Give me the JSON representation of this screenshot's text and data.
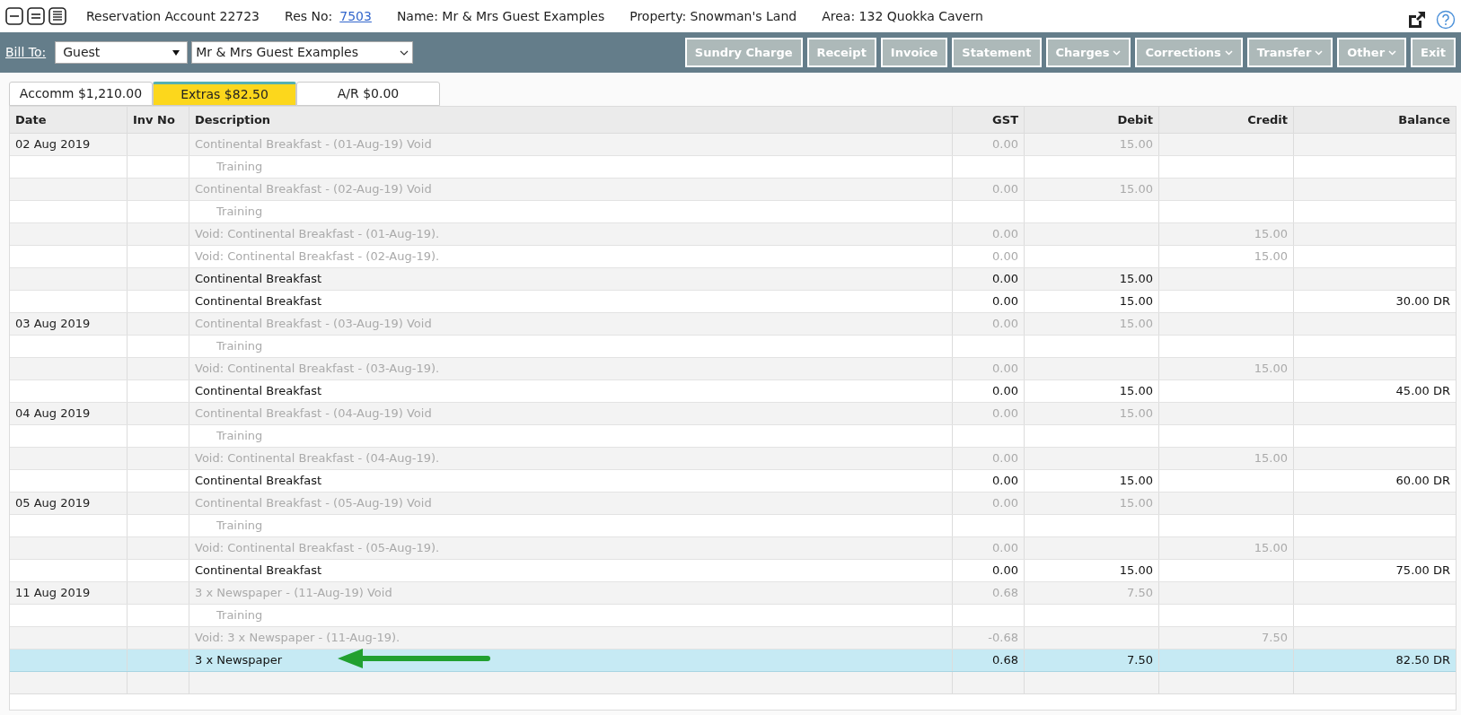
{
  "header": {
    "title": "Reservation Account 22723",
    "res_no_label": "Res No:",
    "res_no": "7503",
    "name": "Name: Mr & Mrs Guest Examples",
    "property": "Property: Snowman's Land",
    "area": "Area: 132 Quokka Cavern"
  },
  "toolbar": {
    "bill_to_label": "Bill To:",
    "bill_to_type": "Guest",
    "bill_to_name": "Mr & Mrs Guest Examples",
    "buttons": [
      {
        "label": "Sundry Charge",
        "dropdown": false
      },
      {
        "label": "Receipt",
        "dropdown": false
      },
      {
        "label": "Invoice",
        "dropdown": false
      },
      {
        "label": "Statement",
        "dropdown": false
      },
      {
        "label": "Charges",
        "dropdown": true
      },
      {
        "label": "Corrections",
        "dropdown": true
      },
      {
        "label": "Transfer",
        "dropdown": true
      },
      {
        "label": "Other",
        "dropdown": true
      },
      {
        "label": "Exit",
        "dropdown": false
      }
    ]
  },
  "tabs": [
    {
      "label": "Accomm $1,210.00",
      "selected": false
    },
    {
      "label": "Extras $82.50",
      "selected": true
    },
    {
      "label": "A/R $0.00",
      "selected": false
    }
  ],
  "table": {
    "columns": [
      "Date",
      "Inv No",
      "Description",
      "GST",
      "Debit",
      "Credit",
      "Balance"
    ],
    "rows": [
      {
        "kind": "void",
        "date": "02 Aug 2019",
        "description": "Continental Breakfast - (01-Aug-19) Void",
        "gst": "0.00",
        "debit": "15.00",
        "credit": "",
        "balance": "",
        "selected": false
      },
      {
        "kind": "note",
        "date": "",
        "description": "Training",
        "gst": "",
        "debit": "",
        "credit": "",
        "balance": "",
        "selected": false
      },
      {
        "kind": "void",
        "date": "",
        "description": "Continental Breakfast - (02-Aug-19) Void",
        "gst": "0.00",
        "debit": "15.00",
        "credit": "",
        "balance": "",
        "selected": false
      },
      {
        "kind": "note",
        "date": "",
        "description": "Training",
        "gst": "",
        "debit": "",
        "credit": "",
        "balance": "",
        "selected": false
      },
      {
        "kind": "void",
        "date": "",
        "description": "Void: Continental Breakfast - (01-Aug-19).",
        "gst": "0.00",
        "debit": "",
        "credit": "15.00",
        "balance": "",
        "selected": false
      },
      {
        "kind": "void",
        "date": "",
        "description": "Void: Continental Breakfast - (02-Aug-19).",
        "gst": "0.00",
        "debit": "",
        "credit": "15.00",
        "balance": "",
        "selected": false
      },
      {
        "kind": "entry",
        "date": "",
        "description": "Continental Breakfast",
        "gst": "0.00",
        "debit": "15.00",
        "credit": "",
        "balance": "",
        "selected": false
      },
      {
        "kind": "entry",
        "date": "",
        "description": "Continental Breakfast",
        "gst": "0.00",
        "debit": "15.00",
        "credit": "",
        "balance": "30.00 DR",
        "selected": false
      },
      {
        "kind": "void",
        "date": "03 Aug 2019",
        "description": "Continental Breakfast - (03-Aug-19) Void",
        "gst": "0.00",
        "debit": "15.00",
        "credit": "",
        "balance": "",
        "selected": false
      },
      {
        "kind": "note",
        "date": "",
        "description": "Training",
        "gst": "",
        "debit": "",
        "credit": "",
        "balance": "",
        "selected": false
      },
      {
        "kind": "void",
        "date": "",
        "description": "Void: Continental Breakfast - (03-Aug-19).",
        "gst": "0.00",
        "debit": "",
        "credit": "15.00",
        "balance": "",
        "selected": false
      },
      {
        "kind": "entry",
        "date": "",
        "description": "Continental Breakfast",
        "gst": "0.00",
        "debit": "15.00",
        "credit": "",
        "balance": "45.00 DR",
        "selected": false
      },
      {
        "kind": "void",
        "date": "04 Aug 2019",
        "description": "Continental Breakfast - (04-Aug-19) Void",
        "gst": "0.00",
        "debit": "15.00",
        "credit": "",
        "balance": "",
        "selected": false
      },
      {
        "kind": "note",
        "date": "",
        "description": "Training",
        "gst": "",
        "debit": "",
        "credit": "",
        "balance": "",
        "selected": false
      },
      {
        "kind": "void",
        "date": "",
        "description": "Void: Continental Breakfast - (04-Aug-19).",
        "gst": "0.00",
        "debit": "",
        "credit": "15.00",
        "balance": "",
        "selected": false
      },
      {
        "kind": "entry",
        "date": "",
        "description": "Continental Breakfast",
        "gst": "0.00",
        "debit": "15.00",
        "credit": "",
        "balance": "60.00 DR",
        "selected": false
      },
      {
        "kind": "void",
        "date": "05 Aug 2019",
        "description": "Continental Breakfast - (05-Aug-19) Void",
        "gst": "0.00",
        "debit": "15.00",
        "credit": "",
        "balance": "",
        "selected": false
      },
      {
        "kind": "note",
        "date": "",
        "description": "Training",
        "gst": "",
        "debit": "",
        "credit": "",
        "balance": "",
        "selected": false
      },
      {
        "kind": "void",
        "date": "",
        "description": "Void: Continental Breakfast - (05-Aug-19).",
        "gst": "0.00",
        "debit": "",
        "credit": "15.00",
        "balance": "",
        "selected": false
      },
      {
        "kind": "entry",
        "date": "",
        "description": "Continental Breakfast",
        "gst": "0.00",
        "debit": "15.00",
        "credit": "",
        "balance": "75.00 DR",
        "selected": false
      },
      {
        "kind": "void",
        "date": "11 Aug 2019",
        "description": "3 x Newspaper - (11-Aug-19) Void",
        "gst": "0.68",
        "debit": "7.50",
        "credit": "",
        "balance": "",
        "selected": false
      },
      {
        "kind": "note",
        "date": "",
        "description": "Training",
        "gst": "",
        "debit": "",
        "credit": "",
        "balance": "",
        "selected": false
      },
      {
        "kind": "void",
        "date": "",
        "description": "Void: 3 x Newspaper - (11-Aug-19).",
        "gst": "-0.68",
        "debit": "",
        "credit": "7.50",
        "balance": "",
        "selected": false
      },
      {
        "kind": "entry",
        "date": "",
        "description": "3 x Newspaper",
        "gst": "0.68",
        "debit": "7.50",
        "credit": "",
        "balance": "82.50 DR",
        "selected": true
      }
    ]
  }
}
